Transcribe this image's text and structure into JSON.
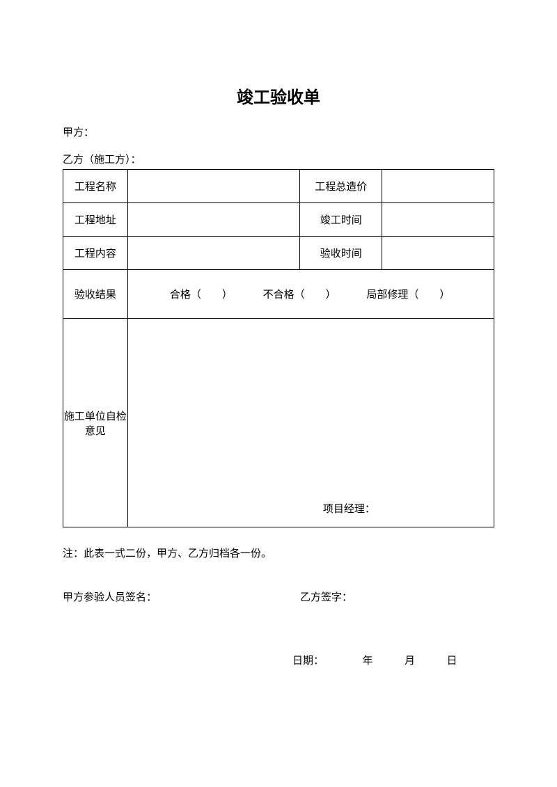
{
  "title": "竣工验收单",
  "partyA_label": "甲方：",
  "partyB_label": "乙方（施工方）：",
  "table": {
    "r1c1": "工程名称",
    "r1c3": "工程总造价",
    "r2c1": "工程地址",
    "r2c3": "竣工时间",
    "r3c1": "工程内容",
    "r3c3": "验收时间",
    "r4c1": "验收结果",
    "result_pass": "合格（　　）",
    "result_fail": "不合格（　　）",
    "result_partial": "局部修理（　　）",
    "r5c1": "施工单位自检意见",
    "pm_label": "项目经理："
  },
  "note": "注：此表一式二份，甲方、乙方归档各一份。",
  "signA": "甲方参验人员签名：",
  "signB": "乙方签字：",
  "date_label": "日期：",
  "year": "年",
  "month": "月",
  "day": "日"
}
